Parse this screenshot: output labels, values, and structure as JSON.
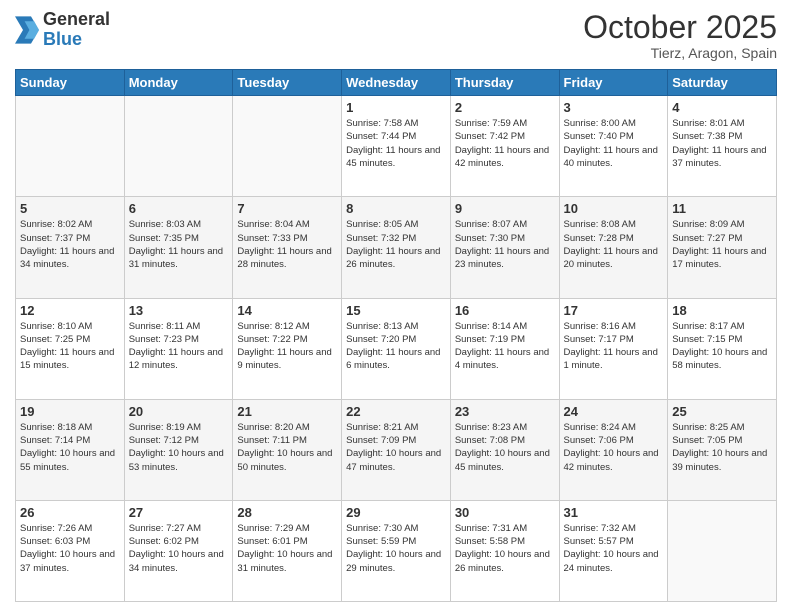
{
  "logo": {
    "general": "General",
    "blue": "Blue"
  },
  "header": {
    "month": "October 2025",
    "location": "Tierz, Aragon, Spain"
  },
  "weekdays": [
    "Sunday",
    "Monday",
    "Tuesday",
    "Wednesday",
    "Thursday",
    "Friday",
    "Saturday"
  ],
  "weeks": [
    [
      {
        "day": "",
        "info": ""
      },
      {
        "day": "",
        "info": ""
      },
      {
        "day": "",
        "info": ""
      },
      {
        "day": "1",
        "info": "Sunrise: 7:58 AM\nSunset: 7:44 PM\nDaylight: 11 hours\nand 45 minutes."
      },
      {
        "day": "2",
        "info": "Sunrise: 7:59 AM\nSunset: 7:42 PM\nDaylight: 11 hours\nand 42 minutes."
      },
      {
        "day": "3",
        "info": "Sunrise: 8:00 AM\nSunset: 7:40 PM\nDaylight: 11 hours\nand 40 minutes."
      },
      {
        "day": "4",
        "info": "Sunrise: 8:01 AM\nSunset: 7:38 PM\nDaylight: 11 hours\nand 37 minutes."
      }
    ],
    [
      {
        "day": "5",
        "info": "Sunrise: 8:02 AM\nSunset: 7:37 PM\nDaylight: 11 hours\nand 34 minutes."
      },
      {
        "day": "6",
        "info": "Sunrise: 8:03 AM\nSunset: 7:35 PM\nDaylight: 11 hours\nand 31 minutes."
      },
      {
        "day": "7",
        "info": "Sunrise: 8:04 AM\nSunset: 7:33 PM\nDaylight: 11 hours\nand 28 minutes."
      },
      {
        "day": "8",
        "info": "Sunrise: 8:05 AM\nSunset: 7:32 PM\nDaylight: 11 hours\nand 26 minutes."
      },
      {
        "day": "9",
        "info": "Sunrise: 8:07 AM\nSunset: 7:30 PM\nDaylight: 11 hours\nand 23 minutes."
      },
      {
        "day": "10",
        "info": "Sunrise: 8:08 AM\nSunset: 7:28 PM\nDaylight: 11 hours\nand 20 minutes."
      },
      {
        "day": "11",
        "info": "Sunrise: 8:09 AM\nSunset: 7:27 PM\nDaylight: 11 hours\nand 17 minutes."
      }
    ],
    [
      {
        "day": "12",
        "info": "Sunrise: 8:10 AM\nSunset: 7:25 PM\nDaylight: 11 hours\nand 15 minutes."
      },
      {
        "day": "13",
        "info": "Sunrise: 8:11 AM\nSunset: 7:23 PM\nDaylight: 11 hours\nand 12 minutes."
      },
      {
        "day": "14",
        "info": "Sunrise: 8:12 AM\nSunset: 7:22 PM\nDaylight: 11 hours\nand 9 minutes."
      },
      {
        "day": "15",
        "info": "Sunrise: 8:13 AM\nSunset: 7:20 PM\nDaylight: 11 hours\nand 6 minutes."
      },
      {
        "day": "16",
        "info": "Sunrise: 8:14 AM\nSunset: 7:19 PM\nDaylight: 11 hours\nand 4 minutes."
      },
      {
        "day": "17",
        "info": "Sunrise: 8:16 AM\nSunset: 7:17 PM\nDaylight: 11 hours\nand 1 minute."
      },
      {
        "day": "18",
        "info": "Sunrise: 8:17 AM\nSunset: 7:15 PM\nDaylight: 10 hours\nand 58 minutes."
      }
    ],
    [
      {
        "day": "19",
        "info": "Sunrise: 8:18 AM\nSunset: 7:14 PM\nDaylight: 10 hours\nand 55 minutes."
      },
      {
        "day": "20",
        "info": "Sunrise: 8:19 AM\nSunset: 7:12 PM\nDaylight: 10 hours\nand 53 minutes."
      },
      {
        "day": "21",
        "info": "Sunrise: 8:20 AM\nSunset: 7:11 PM\nDaylight: 10 hours\nand 50 minutes."
      },
      {
        "day": "22",
        "info": "Sunrise: 8:21 AM\nSunset: 7:09 PM\nDaylight: 10 hours\nand 47 minutes."
      },
      {
        "day": "23",
        "info": "Sunrise: 8:23 AM\nSunset: 7:08 PM\nDaylight: 10 hours\nand 45 minutes."
      },
      {
        "day": "24",
        "info": "Sunrise: 8:24 AM\nSunset: 7:06 PM\nDaylight: 10 hours\nand 42 minutes."
      },
      {
        "day": "25",
        "info": "Sunrise: 8:25 AM\nSunset: 7:05 PM\nDaylight: 10 hours\nand 39 minutes."
      }
    ],
    [
      {
        "day": "26",
        "info": "Sunrise: 7:26 AM\nSunset: 6:03 PM\nDaylight: 10 hours\nand 37 minutes."
      },
      {
        "day": "27",
        "info": "Sunrise: 7:27 AM\nSunset: 6:02 PM\nDaylight: 10 hours\nand 34 minutes."
      },
      {
        "day": "28",
        "info": "Sunrise: 7:29 AM\nSunset: 6:01 PM\nDaylight: 10 hours\nand 31 minutes."
      },
      {
        "day": "29",
        "info": "Sunrise: 7:30 AM\nSunset: 5:59 PM\nDaylight: 10 hours\nand 29 minutes."
      },
      {
        "day": "30",
        "info": "Sunrise: 7:31 AM\nSunset: 5:58 PM\nDaylight: 10 hours\nand 26 minutes."
      },
      {
        "day": "31",
        "info": "Sunrise: 7:32 AM\nSunset: 5:57 PM\nDaylight: 10 hours\nand 24 minutes."
      },
      {
        "day": "",
        "info": ""
      }
    ]
  ]
}
